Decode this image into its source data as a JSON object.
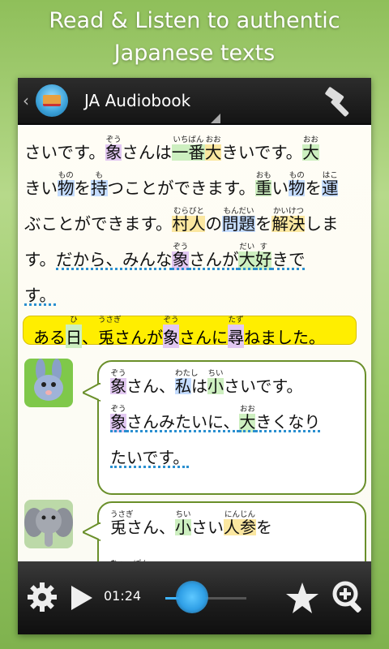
{
  "promo": {
    "line1": "Read & Listen to authentic",
    "line2": "Japanese texts"
  },
  "actionbar": {
    "title": "JA Audiobook",
    "icons": {
      "back": "chevron-left-icon",
      "app": "app-logo-icon",
      "tools": "hammer-icon"
    }
  },
  "story": {
    "lines": [
      [
        {
          "t": "さいです。 "
        },
        {
          "t": "象",
          "r": "ぞう",
          "c": "purple"
        },
        {
          "t": "さんは"
        },
        {
          "t": "一番",
          "r": "いちばん",
          "c": "green"
        },
        {
          "t": "大",
          "r": "おお",
          "c": "yellow"
        },
        {
          "t": "きいです。 "
        },
        {
          "t": "大",
          "r": "おお",
          "c": "green"
        }
      ],
      [
        {
          "t": "きい"
        },
        {
          "t": "物",
          "r": "もの",
          "c": "blue"
        },
        {
          "t": "を"
        },
        {
          "t": "持",
          "r": "も",
          "c": "blue"
        },
        {
          "t": "つことができます。 "
        },
        {
          "t": "重",
          "r": "おも",
          "c": "green"
        },
        {
          "t": "い"
        },
        {
          "t": "物",
          "r": "もの",
          "c": "blue"
        },
        {
          "t": "を"
        },
        {
          "t": "運",
          "r": "はこ",
          "c": "blue"
        }
      ],
      [
        {
          "t": "ぶことができます。 "
        },
        {
          "t": "村人",
          "r": "むらびと",
          "c": "yellow"
        },
        {
          "t": "の"
        },
        {
          "t": "問題",
          "r": "もんだい",
          "c": "blue"
        },
        {
          "t": "を"
        },
        {
          "t": "解決",
          "r": "かいけつ",
          "c": "yellow"
        },
        {
          "t": "しま"
        }
      ],
      [
        {
          "t": "す。 "
        },
        {
          "t": "だから、みんな",
          "u": 1
        },
        {
          "t": "象",
          "r": "ぞう",
          "c": "purple",
          "u": 1
        },
        {
          "t": "さんが",
          "u": 1
        },
        {
          "t": "大",
          "r": "だい",
          "c": "green",
          "u": 1
        },
        {
          "t": "好",
          "r": "す",
          "c": "green",
          "u": 1
        },
        {
          "t": "きで",
          "u": 1
        }
      ],
      [
        {
          "t": "す。",
          "u": 1
        }
      ]
    ],
    "current": [
      {
        "t": "ある"
      },
      {
        "t": "日",
        "r": "ひ",
        "c": "green"
      },
      {
        "t": "、 "
      },
      {
        "t": "兎",
        "r": "うさぎ"
      },
      {
        "t": " さんが"
      },
      {
        "t": "象",
        "r": "ぞう",
        "c": "purple"
      },
      {
        "t": "さんに"
      },
      {
        "t": "尋",
        "r": "たず",
        "c": "purple"
      },
      {
        "t": "ねました。"
      }
    ]
  },
  "dialogue": [
    {
      "speaker": "rabbit",
      "lines": [
        [
          {
            "t": "象",
            "r": "ぞう",
            "c": "purple"
          },
          {
            "t": "さん、 "
          },
          {
            "t": "私",
            "r": "わたし",
            "c": "blue"
          },
          {
            "t": " は"
          },
          {
            "t": "小",
            "r": "ちい",
            "c": "green"
          },
          {
            "t": "さいです。"
          }
        ],
        [
          {
            "t": "象",
            "r": "ぞう",
            "c": "purple",
            "u": 1
          },
          {
            "t": "さんみたいに、",
            "u": 1
          },
          {
            "t": "大",
            "r": "おお",
            "c": "green",
            "u": 1
          },
          {
            "t": "きくなり",
            "u": 1
          }
        ],
        [
          {
            "t": "たいです。",
            "u": 1
          }
        ]
      ]
    },
    {
      "speaker": "elephant",
      "lines": [
        [
          {
            "t": "兎",
            "r": "うさぎ"
          },
          {
            "t": " さん、 "
          },
          {
            "t": "小",
            "r": "ちい",
            "c": "green"
          },
          {
            "t": "さい"
          },
          {
            "t": "人参",
            "r": "にんじん",
            "c": "yellow"
          },
          {
            "t": "を"
          }
        ],
        [
          {
            "t": "",
            "r": "ひゃっぽん"
          },
          {
            "t": "",
            "r": "た"
          },
          {
            "t": ""
          }
        ]
      ]
    }
  ],
  "player": {
    "time": "01:24",
    "progress": 0.33,
    "icons": {
      "settings": "gear-icon",
      "play": "play-icon",
      "favorite": "star-icon",
      "zoom": "zoom-in-icon"
    }
  }
}
